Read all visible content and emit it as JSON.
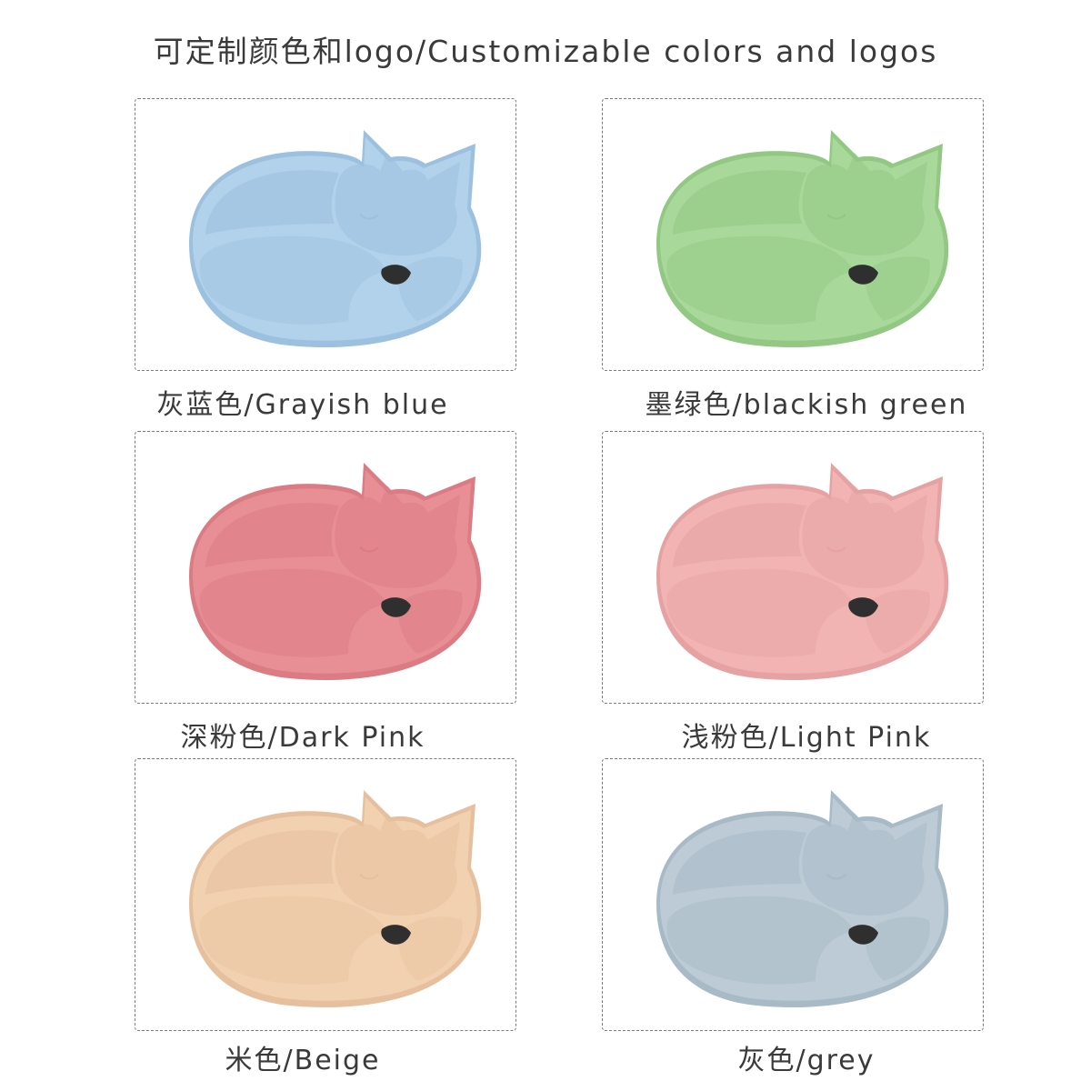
{
  "header": {
    "title": "可定制颜色和logo/Customizable colors and logos"
  },
  "products": [
    {
      "label": "灰蓝色/Grayish blue",
      "color": "#b2d1ea",
      "shade": "#9cc0df"
    },
    {
      "label": "墨绿色/blackish green",
      "color": "#a8d89a",
      "shade": "#92c883"
    },
    {
      "label": "深粉色/Dark Pink",
      "color": "#e88f96",
      "shade": "#db7b83"
    },
    {
      "label": "浅粉色/Light Pink",
      "color": "#f1b4b3",
      "shade": "#e6a2a2"
    },
    {
      "label": "米色/Beige",
      "color": "#f2d1b1",
      "shade": "#e6c09e"
    },
    {
      "label": "灰色/grey",
      "color": "#bccbd6",
      "shade": "#a8bac6"
    }
  ],
  "icons": {
    "plate": "fox-plate-icon"
  }
}
